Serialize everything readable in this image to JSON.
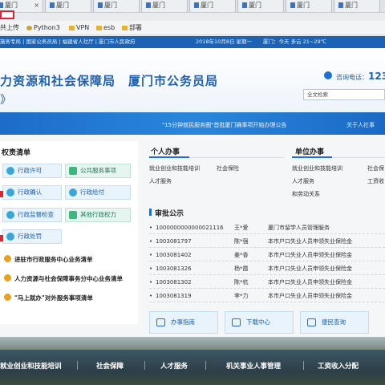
{
  "browser": {
    "tabs": [
      {
        "label": "厦门"
      },
      {
        "label": "厦门"
      },
      {
        "label": "厦门"
      },
      {
        "label": "厦门"
      },
      {
        "label": "厦门"
      },
      {
        "label": "厦门"
      },
      {
        "label": "厦门"
      },
      {
        "label": "厦门"
      }
    ],
    "tab_close": "×",
    "bookmarks": [
      {
        "label": "共上传",
        "icon": "folder-icon"
      },
      {
        "label": "Python3",
        "icon": "python-icon"
      },
      {
        "label": "VPN",
        "icon": "folder-icon"
      },
      {
        "label": "esb",
        "icon": "folder-icon"
      },
      {
        "label": "部署",
        "icon": "folder-icon"
      }
    ]
  },
  "site": {
    "topbar": {
      "text1": "施务专局 | 国家公务员局 | 福建省人社厅 | 厦门市人民政府",
      "date": "2018年10月8日 星期一",
      "weather": "厦门：今天 多云 21~29℃"
    },
    "title": "力资源和社会保障局　厦门市公务员局",
    "title_line2": "》",
    "hotline_label": "咨询电话：",
    "hotline_number": "123",
    "search_placeholder": "全文检索",
    "banner": {
      "notice1": "\"15分钟就民服务圈\"首批厦门确事项开始办理公告",
      "notice2": "关于人社事"
    },
    "left": {
      "heading": "权责清单",
      "buttons": [
        {
          "label": "行政许可"
        },
        {
          "label": "公共服务事项"
        },
        {
          "label": "行政确认"
        },
        {
          "label": "行政给付"
        },
        {
          "label": "行政监督检查"
        },
        {
          "label": "其他行政权力"
        },
        {
          "label": "行政处罚"
        }
      ],
      "links": [
        {
          "label": "进驻市行政服务中心业务清单"
        },
        {
          "label": "人力资源与社会保障事务分中心业务清单"
        },
        {
          "label": "\"马上就办\"对外服务事项清单"
        }
      ]
    },
    "personal": {
      "heading": "个人办事",
      "items": [
        "就业创业和技能培训",
        "社会保险",
        "人才服务"
      ]
    },
    "unit": {
      "heading": "单位办事",
      "items": [
        "就业创业和技能培训",
        "社会保",
        "人才服务",
        "工资收",
        "和劳动关系"
      ]
    },
    "approval": {
      "heading": "审批公示",
      "rows": [
        {
          "id": "1000000000000021116",
          "name": "王*爱",
          "item": "厦门市留学人员管理服务"
        },
        {
          "id": "1003081797",
          "name": "陈*强",
          "item": "本市户口失业人员申领失业保险金"
        },
        {
          "id": "1003081402",
          "name": "姜*香",
          "item": "本市户口失业人员申领失业保险金"
        },
        {
          "id": "1003081326",
          "name": "杨*霞",
          "item": "本市户口失业人员申领失业保险金"
        },
        {
          "id": "1003081302",
          "name": "陈*杭",
          "item": "本市户口失业人员申领失业保险金"
        },
        {
          "id": "1003081319",
          "name": "李*力",
          "item": "本市户口失业人员申领失业保险金"
        }
      ]
    },
    "services": [
      {
        "label": "办事指南"
      },
      {
        "label": "下载中心"
      },
      {
        "label": "便民查询"
      }
    ],
    "bottom_nav": [
      "就业创业和技能培训",
      "社会保障",
      "人才服务",
      "机关事业人事管理",
      "工资收入分配"
    ]
  }
}
